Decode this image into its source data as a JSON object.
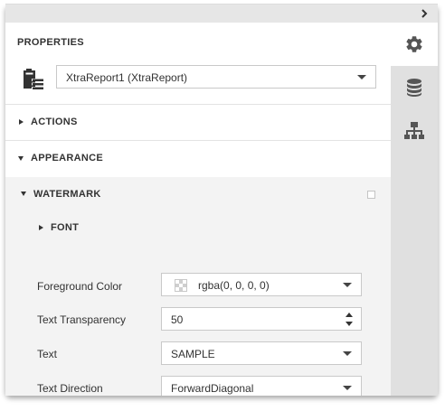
{
  "panel": {
    "title": "PROPERTIES",
    "report_selector": {
      "value": "XtraReport1 (XtraReport)"
    }
  },
  "sections": [
    {
      "label": "ACTIONS",
      "expanded": false
    },
    {
      "label": "APPEARANCE",
      "expanded": true
    }
  ],
  "watermark": {
    "label": "WATERMARK",
    "checked": false,
    "font_group": {
      "label": "FONT",
      "expanded": false
    },
    "properties": [
      {
        "label": "Foreground Color",
        "value": "rgba(0, 0, 0, 0)",
        "editor": "color-dropdown"
      },
      {
        "label": "Text Transparency",
        "value": "50",
        "editor": "spinner"
      },
      {
        "label": "Text",
        "value": "SAMPLE",
        "editor": "dropdown"
      },
      {
        "label": "Text Direction",
        "value": "ForwardDiagonal",
        "editor": "dropdown"
      }
    ]
  },
  "sidebar": {
    "tabs": [
      {
        "icon": "gear-icon",
        "active": true
      },
      {
        "icon": "database-icon",
        "active": false
      },
      {
        "icon": "hierarchy-icon",
        "active": false
      }
    ]
  },
  "colors": {
    "icon_gray": "#555555",
    "sidebar_bg": "#e0e0e0",
    "subsection_bg": "#f3f3f3"
  }
}
